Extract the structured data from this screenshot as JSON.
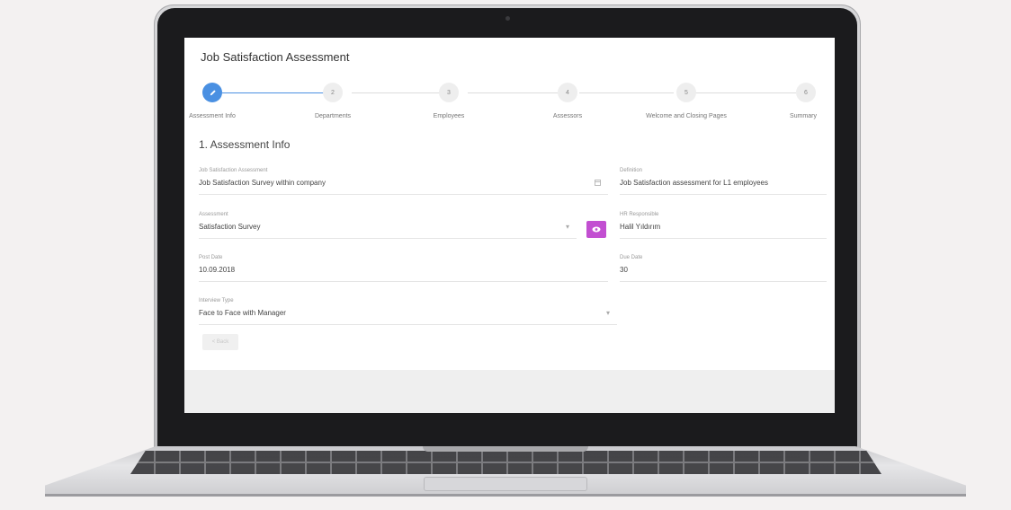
{
  "page": {
    "title": "Job Satisfaction Assessment",
    "section_title": "1. Assessment Info"
  },
  "steps": [
    {
      "number": "",
      "label": "Assessment Info",
      "active": true
    },
    {
      "number": "2",
      "label": "Departments"
    },
    {
      "number": "3",
      "label": "Employees"
    },
    {
      "number": "4",
      "label": "Assessors"
    },
    {
      "number": "5",
      "label": "Welcome and Closing Pages"
    },
    {
      "number": "6",
      "label": "Summary"
    }
  ],
  "fields": {
    "job_satisfaction_assessment": {
      "label": "Job Satisfaction Assessment",
      "value": "Job Satisfaction Survey within company"
    },
    "definition": {
      "label": "Definition",
      "value": "Job Satisfaction assessment for L1 employees"
    },
    "assessment": {
      "label": "Assessment",
      "value": "Satisfaction Survey"
    },
    "hr_responsible": {
      "label": "HR Responsible",
      "value": "Halil Yıldırım"
    },
    "post_date": {
      "label": "Post Date",
      "value": "10.09.2018"
    },
    "due_date": {
      "label": "Due Date",
      "value": "30"
    },
    "interview_type": {
      "label": "Interview Type",
      "value": "Face to Face with Manager"
    }
  },
  "buttons": {
    "back": "< Back"
  },
  "icons": {
    "edit": "pencil-icon",
    "calendar": "calendar-icon",
    "dropdown": "caret-down-icon",
    "preview": "eye-icon"
  },
  "colors": {
    "accent": "#4a90e2",
    "preview_button": "#c24fd1"
  }
}
